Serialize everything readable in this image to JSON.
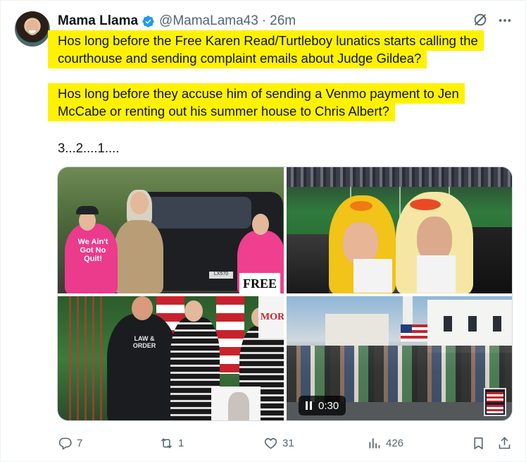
{
  "author": {
    "name": "Mama Llama",
    "handle": "@MamaLama43",
    "separator": "·",
    "time": "26m"
  },
  "body": {
    "paragraph1": "Hos long before the Free Karen Read/Turtleboy lunatics starts calling the courthouse and sending complaint emails about Judge Gildea?",
    "paragraph2": "Hos long before they accuse him of sending a Venmo payment to Jen McCabe or renting out his summer house to Chris Albert?",
    "paragraph3": "3...2....1...."
  },
  "highlight_color": "#fff200",
  "media": {
    "cell1": {
      "shirt_text": "We Ain't Got No Quit!",
      "sign_text": "FREE",
      "plate_text": "LX570"
    },
    "cell3": {
      "shirt_text": "LAW & ORDER",
      "sign_text": "MOR"
    },
    "video": {
      "duration": "0:30",
      "state_icon": "pause-icon"
    }
  },
  "actions": {
    "replies": "7",
    "reposts": "1",
    "likes": "31",
    "views": "426"
  },
  "colors": {
    "text": "#0f1419",
    "secondary": "#536471",
    "verified": "#1d9bf0"
  },
  "icons": [
    "verified-badge-icon",
    "grok-icon",
    "more-icon",
    "reply-icon",
    "repost-icon",
    "like-icon",
    "views-icon",
    "bookmark-icon",
    "share-icon"
  ]
}
